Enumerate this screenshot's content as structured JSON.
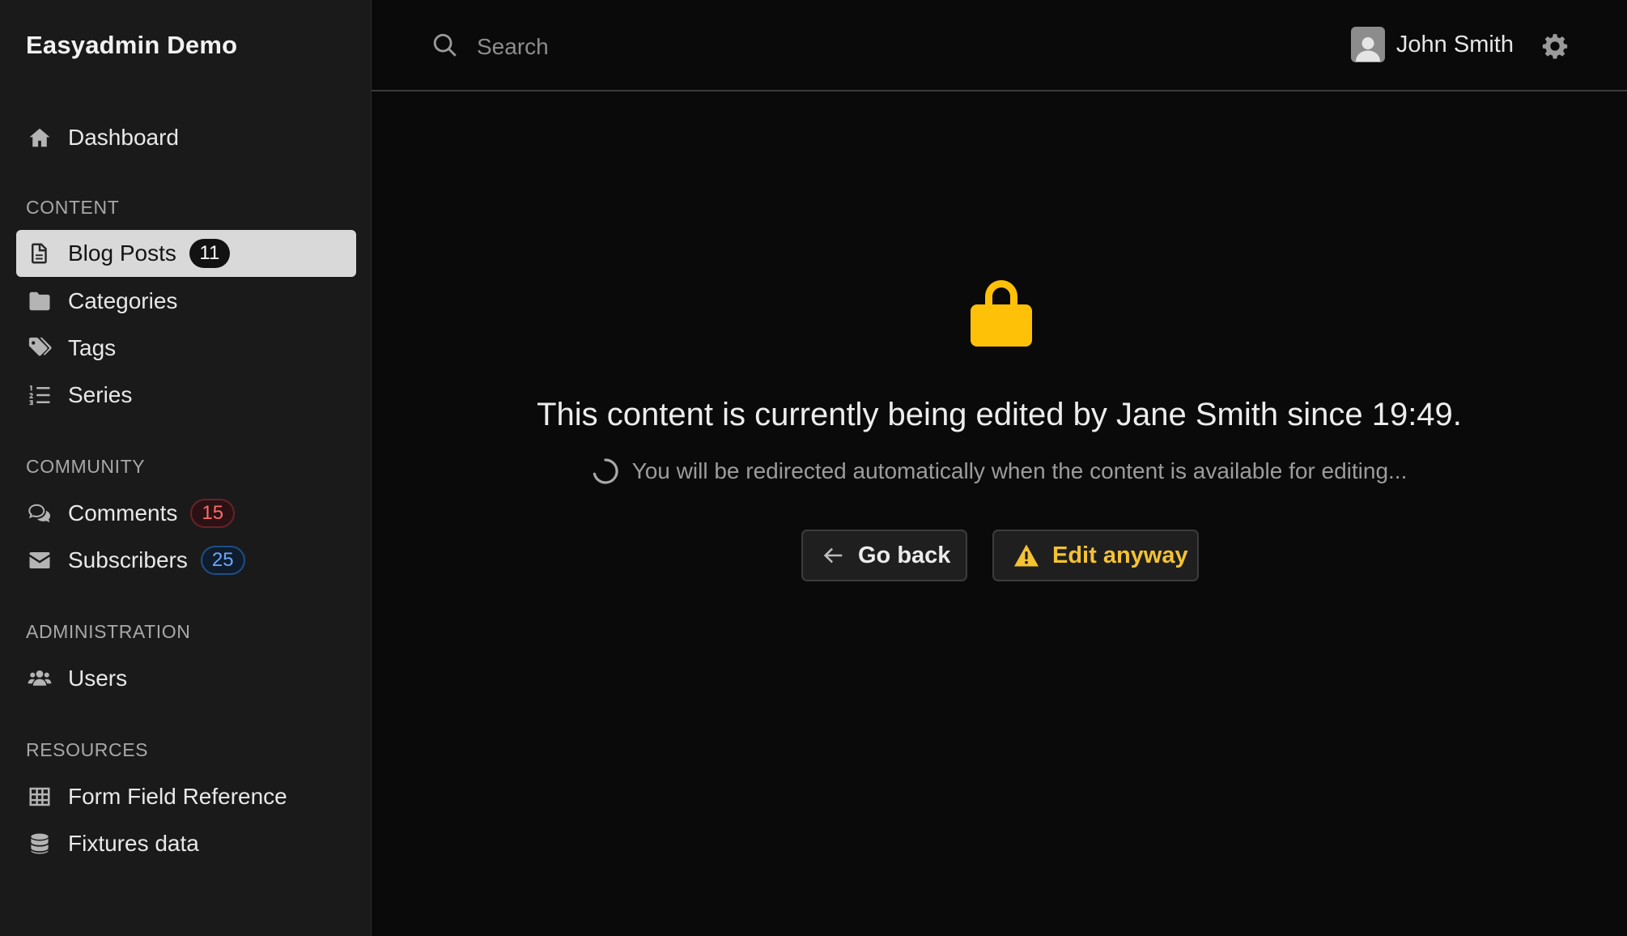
{
  "app": {
    "brand": "Easyadmin Demo"
  },
  "sidebar": {
    "dashboard": {
      "label": "Dashboard",
      "icon": "home-icon"
    },
    "sections": {
      "content": "CONTENT",
      "community": "COMMUNITY",
      "administration": "ADMINISTRATION",
      "resources": "RESOURCES"
    },
    "items": {
      "blog_posts": {
        "label": "Blog Posts",
        "badge": "11",
        "icon": "file-text-icon",
        "active": true
      },
      "categories": {
        "label": "Categories",
        "icon": "folder-icon"
      },
      "tags": {
        "label": "Tags",
        "icon": "tags-icon"
      },
      "series": {
        "label": "Series",
        "icon": "list-ol-icon"
      },
      "comments": {
        "label": "Comments",
        "badge": "15",
        "icon": "comments-icon"
      },
      "subscribers": {
        "label": "Subscribers",
        "badge": "25",
        "icon": "envelope-icon"
      },
      "users": {
        "label": "Users",
        "icon": "users-icon"
      },
      "form_field_reference": {
        "label": "Form Field Reference",
        "icon": "table-icon"
      },
      "fixtures_data": {
        "label": "Fixtures data",
        "icon": "database-icon"
      }
    }
  },
  "header": {
    "search": {
      "placeholder": "Search",
      "value": ""
    },
    "user": {
      "name": "John Smith"
    }
  },
  "main": {
    "message": "This content is currently being edited by Jane Smith since 19:49.",
    "subtext": "You will be redirected automatically when the content is available for editing...",
    "go_back_label": "Go back",
    "edit_anyway_label": "Edit anyway"
  },
  "colors": {
    "lock": "#ffc107",
    "warning_text": "#f4c233",
    "badge_red": "#ff6b6b",
    "badge_blue": "#6aa9ff"
  }
}
